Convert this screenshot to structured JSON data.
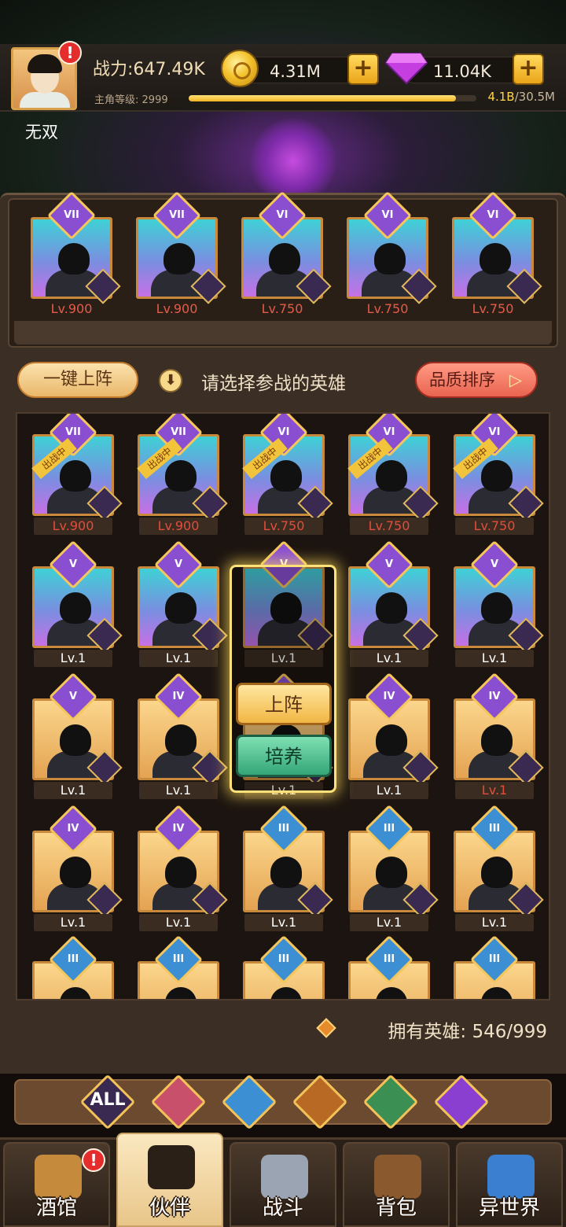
{
  "player": {
    "name": "无双",
    "power": "战力:647.49K",
    "level_label": "主角等级:",
    "level": "2999",
    "exp_current": "4.1B",
    "exp_total": "/30.5M",
    "exp_progress": 0.93
  },
  "currency": {
    "gold": "4.31M",
    "gems": "11.04K",
    "add_label": "+"
  },
  "team": [
    {
      "rank": "VII",
      "level": "Lv.900"
    },
    {
      "rank": "VII",
      "level": "Lv.900"
    },
    {
      "rank": "VI",
      "level": "Lv.750"
    },
    {
      "rank": "VI",
      "level": "Lv.750"
    },
    {
      "rank": "VI",
      "level": "Lv.750"
    }
  ],
  "toolbar": {
    "one_click_label": "一键上阵",
    "hint": "请选择参战的英雄",
    "sort_label": "品质排序",
    "sort_arrow": "▷",
    "info_icon": "⬇"
  },
  "roster": {
    "in_battle_tag": "出战中",
    "rows": [
      [
        {
          "rank": "VII",
          "level": "Lv.900",
          "in_battle": true
        },
        {
          "rank": "VII",
          "level": "Lv.900",
          "in_battle": true
        },
        {
          "rank": "VI",
          "level": "Lv.750",
          "in_battle": true
        },
        {
          "rank": "VI",
          "level": "Lv.750",
          "in_battle": true
        },
        {
          "rank": "VI",
          "level": "Lv.750",
          "in_battle": true
        }
      ],
      [
        {
          "rank": "V",
          "level": "Lv.1"
        },
        {
          "rank": "V",
          "level": "Lv.1"
        },
        {
          "rank": "V",
          "level": "Lv.1"
        },
        {
          "rank": "V",
          "level": "Lv.1"
        },
        {
          "rank": "V",
          "level": "Lv.1"
        }
      ],
      [
        {
          "rank": "V",
          "level": "Lv.1"
        },
        {
          "rank": "IV",
          "level": "Lv.1"
        },
        {
          "rank": "IV",
          "level": "Lv.1"
        },
        {
          "rank": "IV",
          "level": "Lv.1"
        },
        {
          "rank": "IV",
          "level": "Lv.1"
        }
      ],
      [
        {
          "rank": "IV",
          "level": "Lv.1"
        },
        {
          "rank": "IV",
          "level": "Lv.1"
        },
        {
          "rank": "III",
          "level": "Lv.1"
        },
        {
          "rank": "III",
          "level": "Lv.1"
        },
        {
          "rank": "III",
          "level": "Lv.1"
        }
      ],
      [
        {
          "rank": "III",
          "level": ""
        },
        {
          "rank": "III",
          "level": ""
        },
        {
          "rank": "III",
          "level": ""
        },
        {
          "rank": "III",
          "level": ""
        },
        {
          "rank": "III",
          "level": ""
        }
      ]
    ]
  },
  "popup": {
    "deploy_label": "上阵",
    "train_label": "培养"
  },
  "owned": {
    "label": "拥有英雄:",
    "count": "546/999"
  },
  "filters": [
    {
      "label": "ALL",
      "icon": "all-icon"
    },
    {
      "label": "",
      "icon": "knight-helmet-icon"
    },
    {
      "label": "",
      "icon": "fish-creature-icon"
    },
    {
      "label": "",
      "icon": "lion-icon"
    },
    {
      "label": "",
      "icon": "elf-icon"
    },
    {
      "label": "",
      "icon": "demon-icon"
    }
  ],
  "nav": [
    {
      "label": "酒馆",
      "icon": "tavern-mug-icon",
      "alert": true
    },
    {
      "label": "伙伴",
      "icon": "companion-icon",
      "active": true
    },
    {
      "label": "战斗",
      "icon": "crossed-swords-icon"
    },
    {
      "label": "背包",
      "icon": "backpack-chest-icon"
    },
    {
      "label": "异世界",
      "icon": "portal-icon"
    }
  ],
  "colors": {
    "accent_gold": "#f4c65b",
    "rank_purple": "#8a4fd1",
    "rank_blue": "#3d8fd3",
    "level_red": "#e44d3b"
  }
}
